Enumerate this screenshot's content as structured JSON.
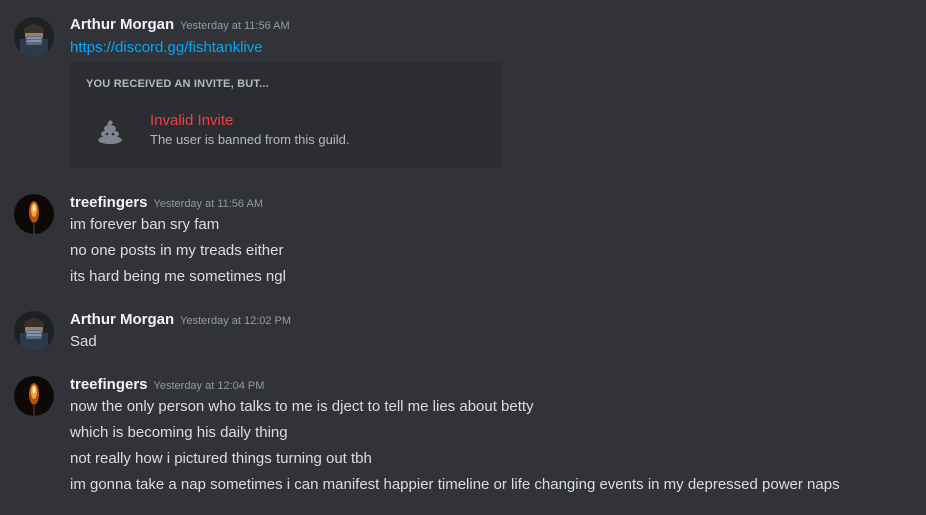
{
  "messages": [
    {
      "author": "Arthur Morgan",
      "timestamp": "Yesterday at 11:56 AM",
      "link": "https://discord.gg/fishtanklive",
      "invite": {
        "heading": "YOU RECEIVED AN INVITE, BUT...",
        "title": "Invalid Invite",
        "description": "The user is banned from this guild.",
        "icon": "poop-icon"
      }
    },
    {
      "author": "treefingers",
      "timestamp": "Yesterday at 11:56 AM",
      "lines": [
        "im forever ban sry fam",
        "no one posts in my treads either",
        "its hard being me sometimes ngl"
      ]
    },
    {
      "author": "Arthur Morgan",
      "timestamp": "Yesterday at 12:02 PM",
      "lines": [
        "Sad"
      ]
    },
    {
      "author": "treefingers",
      "timestamp": "Yesterday at 12:04 PM",
      "lines": [
        "now the only person who talks to me is dject to tell me lies about betty",
        "which is becoming his daily thing",
        "not really how i pictured things turning out tbh",
        "im gonna take a nap sometimes i can manifest happier timeline or life changing events in my depressed power naps"
      ]
    }
  ],
  "colors": {
    "background": "#313338",
    "link": "#00a8fc",
    "invalid": "#f23f43"
  }
}
